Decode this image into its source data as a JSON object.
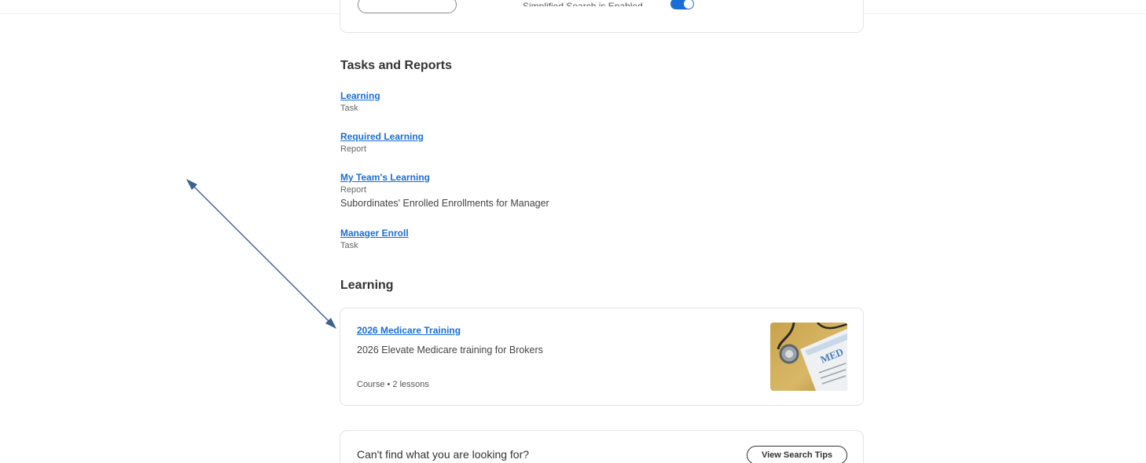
{
  "top_card": {
    "toggle_label": "Simplified Search is Enabled",
    "toggle_on": true
  },
  "tasks_section": {
    "title": "Tasks and Reports",
    "items": [
      {
        "link": "Learning",
        "type": "Task"
      },
      {
        "link": "Required Learning",
        "type": "Report"
      },
      {
        "link": "My Team's Learning",
        "type": "Report",
        "description": "Subordinates' Enrolled Enrollments for Manager"
      },
      {
        "link": "Manager Enroll",
        "type": "Task"
      }
    ]
  },
  "learning_section": {
    "title": "Learning",
    "course": {
      "title": "2026 Medicare Training",
      "description": "2026 Elevate Medicare training for Brokers",
      "meta": "Course  •  2 lessons",
      "thumbnail_icon": "medicare-clipboard-stethoscope-image"
    }
  },
  "help": {
    "text": "Can't find what you are looking for?",
    "button_label": "View Search Tips"
  },
  "colors": {
    "link": "#1a6ed6",
    "annotation_arrow": "#3f5f8f"
  }
}
